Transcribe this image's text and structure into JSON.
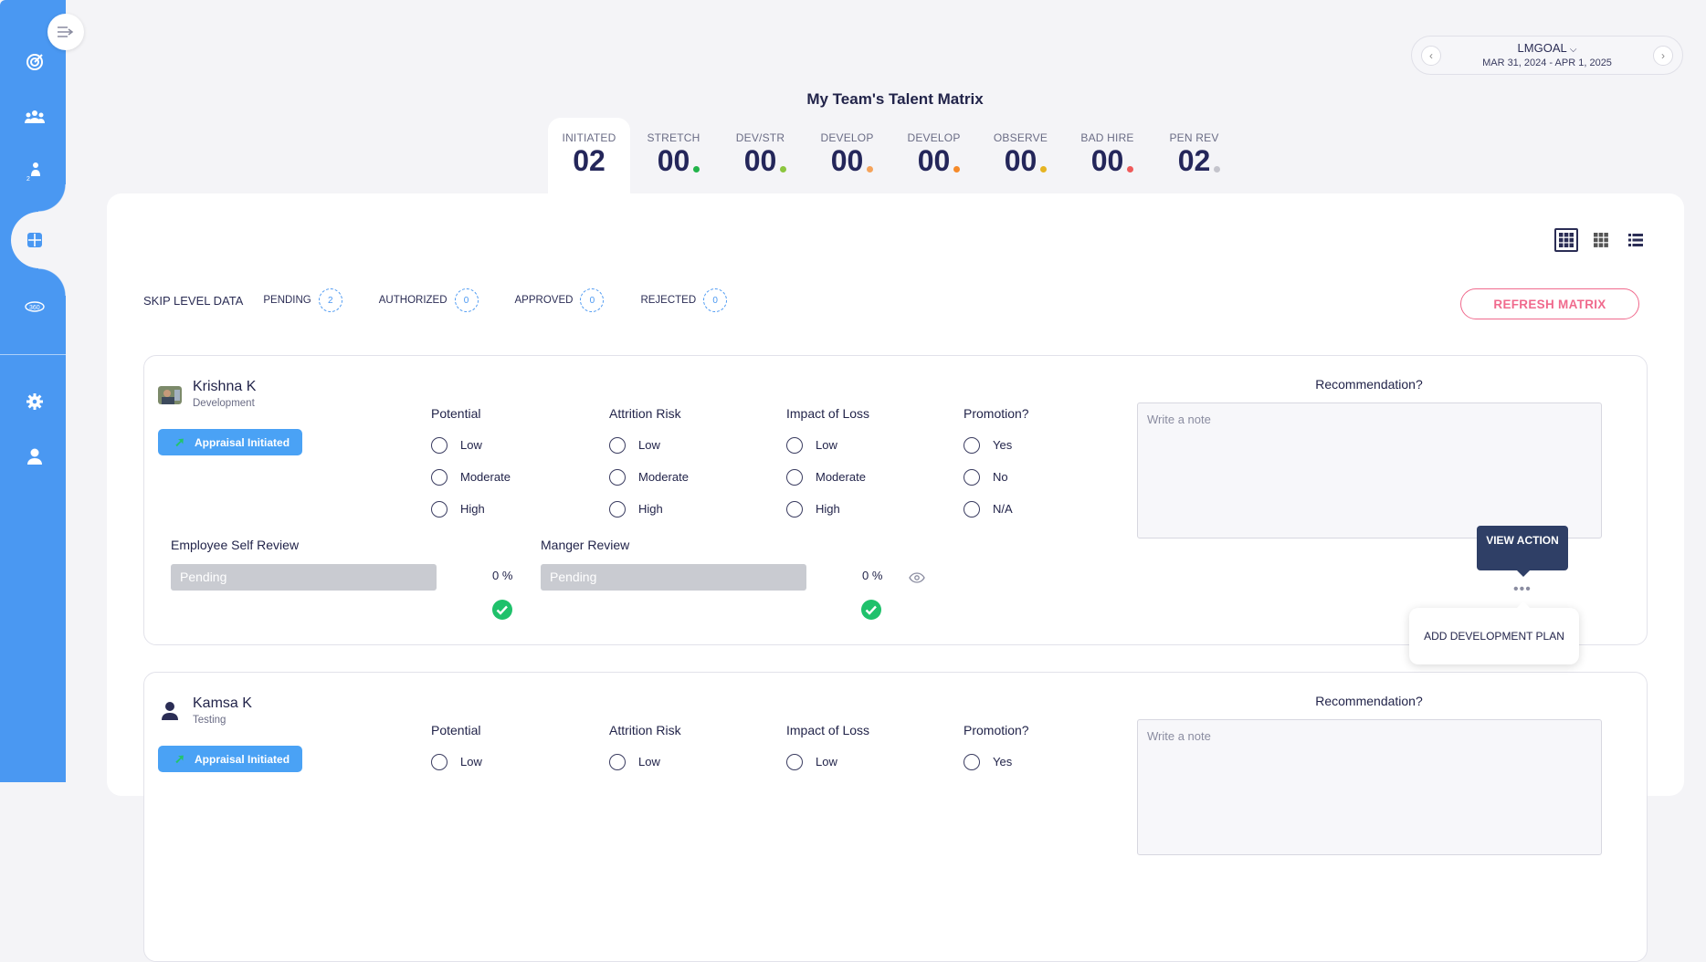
{
  "header": {
    "page_title": "My Team's Talent Matrix",
    "goal": {
      "title": "LMGOAL",
      "range": "MAR 31, 2024 - APR 1, 2025",
      "prev": "‹",
      "next": "›",
      "chevron": "⌵"
    }
  },
  "tabs": [
    {
      "label": "INITIATED",
      "count": "02",
      "dot": ""
    },
    {
      "label": "STRETCH",
      "count": "00",
      "dot": "#22b34a"
    },
    {
      "label": "DEV/STR",
      "count": "00",
      "dot": "#8cc63f"
    },
    {
      "label": "DEVELOP",
      "count": "00",
      "dot": "#f5a35a"
    },
    {
      "label": "DEVELOP",
      "count": "00",
      "dot": "#f58a2a"
    },
    {
      "label": "OBSERVE",
      "count": "00",
      "dot": "#e6b422"
    },
    {
      "label": "BAD HIRE",
      "count": "00",
      "dot": "#ef5a5a"
    },
    {
      "label": "PEN REV",
      "count": "02",
      "dot": "#c4c4cc"
    }
  ],
  "skip": {
    "title": "SKIP LEVEL DATA",
    "items": [
      {
        "label": "PENDING",
        "count": "2"
      },
      {
        "label": "AUTHORIZED",
        "count": "0"
      },
      {
        "label": "APPROVED",
        "count": "0"
      },
      {
        "label": "REJECTED",
        "count": "0"
      }
    ]
  },
  "refresh_label": "REFRESH MATRIX",
  "questions": {
    "potential": {
      "title": "Potential",
      "options": [
        "Low",
        "Moderate",
        "High"
      ]
    },
    "attrition": {
      "title": "Attrition Risk",
      "options": [
        "Low",
        "Moderate",
        "High"
      ]
    },
    "impact": {
      "title": "Impact of Loss",
      "options": [
        "Low",
        "Moderate",
        "High"
      ]
    },
    "promotion": {
      "title": "Promotion?",
      "options": [
        "Yes",
        "No",
        "N/A"
      ]
    }
  },
  "employees": [
    {
      "name": "Krishna K",
      "dept": "Development",
      "status": "Appraisal Initiated",
      "rec_title": "Recommendation?",
      "rec_placeholder": "Write a note",
      "self_review": {
        "label": "Employee Self Review",
        "status": "Pending",
        "pct": "0 %"
      },
      "manager_review": {
        "label": "Manger Review",
        "status": "Pending",
        "pct": "0 %"
      }
    },
    {
      "name": "Kamsa K",
      "dept": "Testing",
      "status": "Appraisal Initiated",
      "rec_title": "Recommendation?",
      "rec_placeholder": "Write a note"
    }
  ],
  "action_menu": {
    "view_action": "VIEW ACTION",
    "add_plan": "ADD DEVELOPMENT PLAN",
    "dots": "•••"
  },
  "colors": {
    "sidebar": "#4a98f2",
    "accent_pink": "#f06a8d",
    "success": "#1fc16b",
    "tooltip": "#2f3f66"
  }
}
